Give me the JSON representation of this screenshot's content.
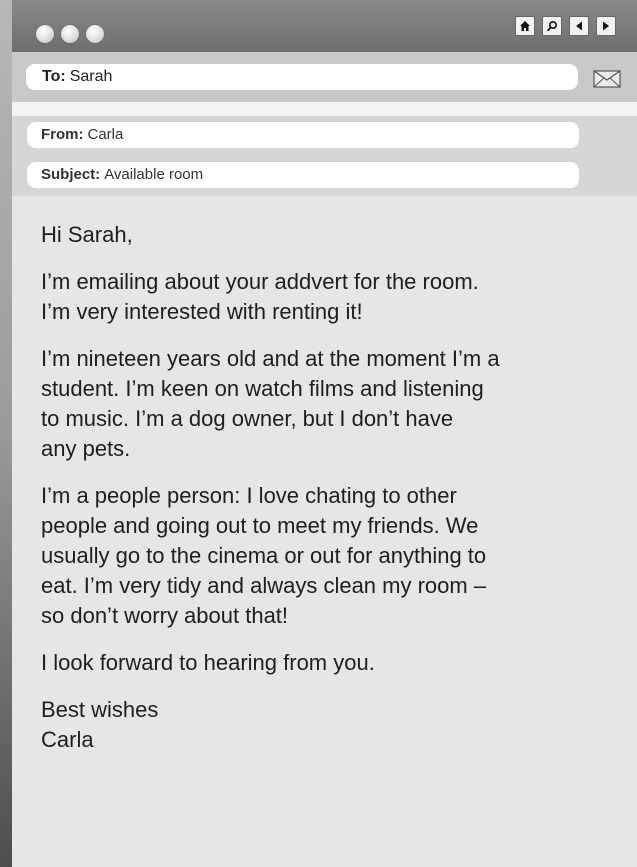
{
  "window": {
    "controls": [
      "home-icon",
      "search-icon",
      "back-arrow-icon",
      "forward-arrow-icon"
    ]
  },
  "to": {
    "label": "To:",
    "value": "Sarah"
  },
  "from": {
    "label": "From:",
    "value": "Carla"
  },
  "subject": {
    "label": "Subject:",
    "value": "Available room"
  },
  "message": {
    "greeting": "Hi Sarah,",
    "p1": "I’m emailing about your addvert for the room.\nI’m very interested with renting it!",
    "p2": "I’m nineteen years old and at the moment I’m a\nstudent. I’m keen on watch films and listening\nto music. I’m a dog owner, but I don’t have\nany pets.",
    "p3": "I’m a people person: I love chating to other\npeople and going out to meet my friends. We\nusually go to the cinema or out for anything to\neat. I’m very tidy and always clean my room –\nso don’t worry about that!",
    "p4": "I look forward to hearing from you.",
    "signoff": "Best wishes\nCarla"
  }
}
